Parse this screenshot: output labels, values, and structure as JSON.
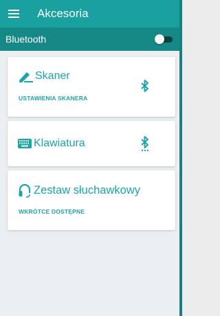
{
  "appbar": {
    "title": "Akcesoria",
    "menu_icon": "menu-icon"
  },
  "bluetooth": {
    "label": "Bluetooth",
    "enabled": false
  },
  "cards": [
    {
      "title": "Skaner",
      "icon": "pencil-icon",
      "action": "USTAWIENIA SKANERA",
      "status_icon": "bluetooth-icon"
    },
    {
      "title": "Klawiatura",
      "icon": "keyboard-icon",
      "status_icon": "bluetooth-searching-icon"
    },
    {
      "title": "Zestaw słuchawkowy",
      "icon": "headset-icon",
      "action": "WKRÓTCE DOSTĘPNE"
    }
  ],
  "colors": {
    "appbar": "#19a09f",
    "btbar": "#168987",
    "accent": "#1ba4aa",
    "background": "#eceff1"
  }
}
